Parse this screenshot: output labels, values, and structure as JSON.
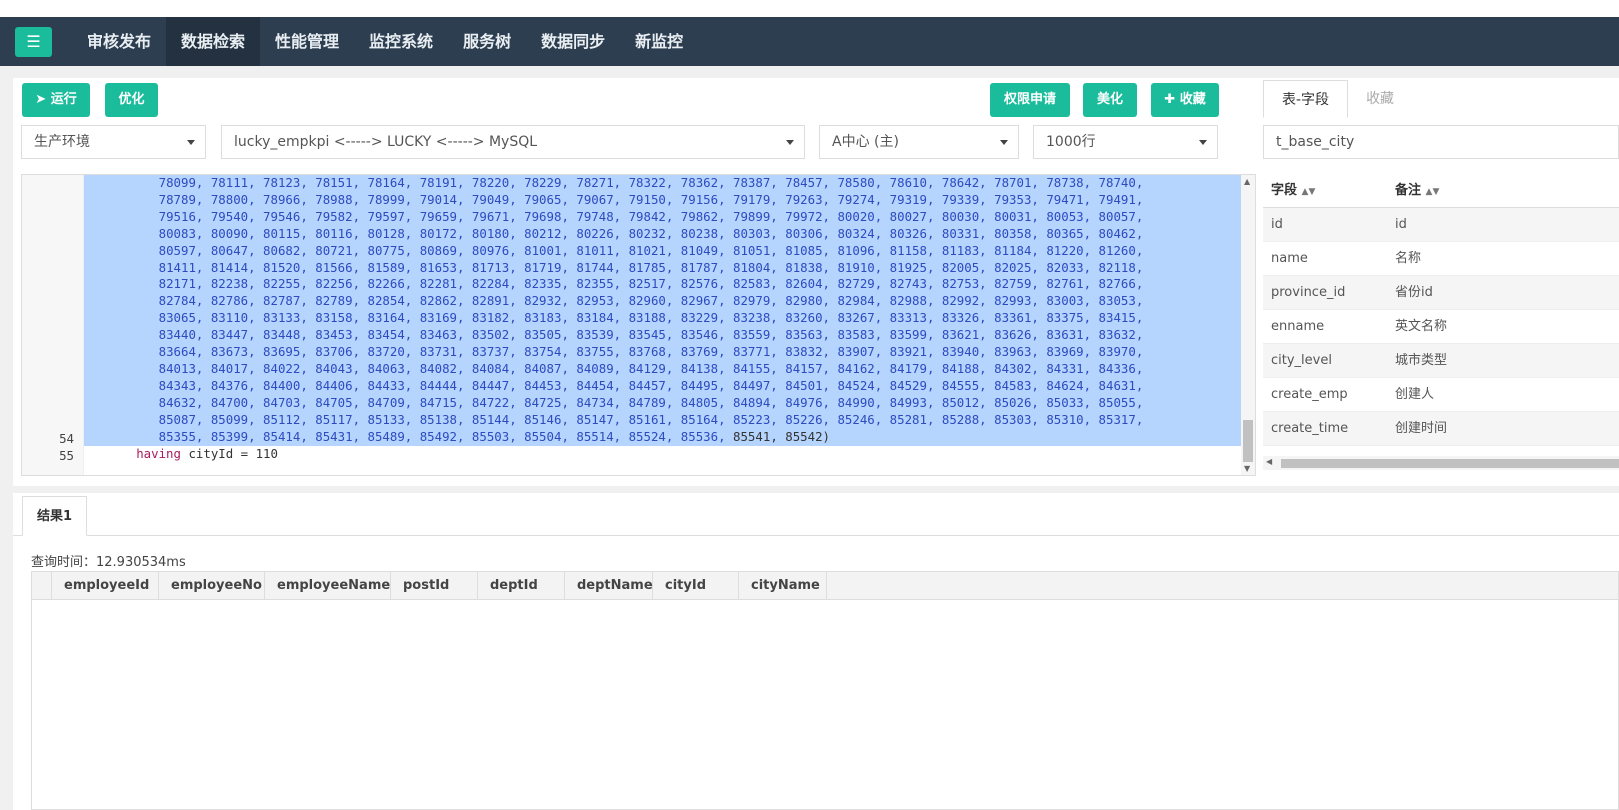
{
  "nav": {
    "items": [
      "审核发布",
      "数据检索",
      "性能管理",
      "监控系统",
      "服务树",
      "数据同步",
      "新监控"
    ],
    "active_index": 1
  },
  "toolbar": {
    "run_label": "运行",
    "optimize_label": "优化",
    "permission_label": "权限申请",
    "beautify_label": "美化",
    "favorite_label": "收藏"
  },
  "selects": {
    "env": "生产环境",
    "db": "lucky_empkpi <-----> LUCKY <-----> MySQL",
    "center": "A中心 (主)",
    "rows": "1000行",
    "table": "t_base_city"
  },
  "side_tabs": [
    "表-字段",
    "收藏"
  ],
  "fields": {
    "header": [
      "字段",
      "备注"
    ],
    "rows": [
      [
        "id",
        "id"
      ],
      [
        "name",
        "名称"
      ],
      [
        "province_id",
        "省份id"
      ],
      [
        "enname",
        "英文名称"
      ],
      [
        "city_level",
        "城市类型"
      ],
      [
        "create_emp",
        "创建人"
      ],
      [
        "create_time",
        "创建时间"
      ]
    ]
  },
  "editor": {
    "lines": [
      "78099, 78111, 78123, 78151, 78164, 78191, 78220, 78229, 78271, 78322, 78362, 78387, 78457, 78580, 78610, 78642, 78701, 78738, 78740,",
      "78789, 78800, 78966, 78988, 78999, 79014, 79049, 79065, 79067, 79150, 79156, 79179, 79263, 79274, 79319, 79339, 79353, 79471, 79491,",
      "79516, 79540, 79546, 79582, 79597, 79659, 79671, 79698, 79748, 79842, 79862, 79899, 79972, 80020, 80027, 80030, 80031, 80053, 80057,",
      "80083, 80090, 80115, 80116, 80128, 80172, 80180, 80212, 80226, 80232, 80238, 80303, 80306, 80324, 80326, 80331, 80358, 80365, 80462,",
      "80597, 80647, 80682, 80721, 80775, 80869, 80976, 81001, 81011, 81021, 81049, 81051, 81085, 81096, 81158, 81183, 81184, 81220, 81260,",
      "81411, 81414, 81520, 81566, 81589, 81653, 81713, 81719, 81744, 81785, 81787, 81804, 81838, 81910, 81925, 82005, 82025, 82033, 82118,",
      "82171, 82238, 82255, 82256, 82266, 82281, 82284, 82335, 82355, 82517, 82576, 82583, 82604, 82729, 82743, 82753, 82759, 82761, 82766,",
      "82784, 82786, 82787, 82789, 82854, 82862, 82891, 82932, 82953, 82960, 82967, 82979, 82980, 82984, 82988, 82992, 82993, 83003, 83053,",
      "83065, 83110, 83133, 83158, 83164, 83169, 83182, 83183, 83184, 83188, 83229, 83238, 83260, 83267, 83313, 83326, 83361, 83375, 83415,",
      "83440, 83447, 83448, 83453, 83454, 83463, 83502, 83505, 83539, 83545, 83546, 83559, 83563, 83583, 83599, 83621, 83626, 83631, 83632,",
      "83664, 83673, 83695, 83706, 83720, 83731, 83737, 83754, 83755, 83768, 83769, 83771, 83832, 83907, 83921, 83940, 83963, 83969, 83970,",
      "84013, 84017, 84022, 84043, 84063, 84082, 84084, 84087, 84089, 84129, 84138, 84155, 84157, 84162, 84179, 84188, 84302, 84331, 84336,",
      "84343, 84376, 84400, 84406, 84433, 84444, 84447, 84453, 84454, 84457, 84495, 84497, 84501, 84524, 84529, 84555, 84583, 84624, 84631,",
      "84632, 84700, 84703, 84705, 84709, 84715, 84722, 84725, 84734, 84789, 84805, 84894, 84976, 84990, 84993, 85012, 85026, 85033, 85055,",
      "85087, 85099, 85112, 85117, 85133, 85138, 85144, 85146, 85147, 85161, 85164, 85223, 85226, 85246, 85281, 85288, 85303, 85310, 85317,"
    ],
    "last_values_line": "85355, 85399, 85414, 85431, 85489, 85492, 85503, 85504, 85514, 85524, 85536, ",
    "last_values_tail": "85541, 85542)",
    "line54_num": "54",
    "line54_kw": "having",
    "line54_rest": " cityId = 110",
    "line55_num": "55"
  },
  "result": {
    "tab_label": "结果1",
    "query_time": "查询时间：12.930534ms",
    "columns": [
      "employeeId",
      "employeeNo",
      "employeeName",
      "postId",
      "deptId",
      "deptName",
      "cityId",
      "cityName"
    ]
  }
}
